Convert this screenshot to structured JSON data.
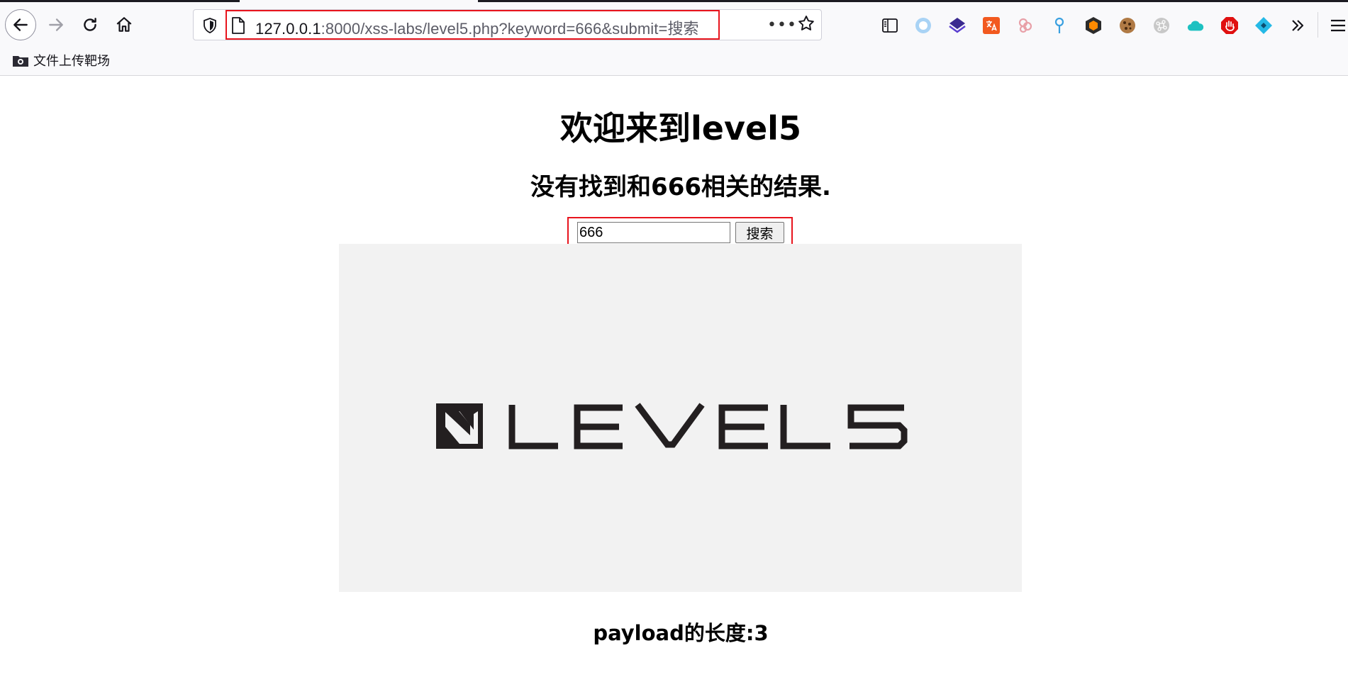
{
  "browser": {
    "url": {
      "host": "127.0.0.1",
      "rest": ":8000/xss-labs/level5.php?keyword=666&submit=搜索"
    },
    "bookmarks": [
      {
        "label": "文件上传靶场",
        "icon": "folder-icon"
      }
    ],
    "toolbar_icons": [
      "back-icon",
      "forward-icon",
      "reload-icon",
      "home-icon",
      "shield-icon",
      "page-icon",
      "more-icon",
      "star-icon",
      "sidebar-icon",
      "overflow-chevrons-icon",
      "menu-icon"
    ],
    "extensions": [
      "circle-extension-icon",
      "layers-extension-icon",
      "translate-extension-icon",
      "rings-extension-icon",
      "pin-extension-icon",
      "shield-extension-icon",
      "cookie-extension-icon",
      "command-extension-icon",
      "cloud-extension-icon",
      "stop-extension-icon",
      "diamond-extension-icon"
    ]
  },
  "page": {
    "heading": "欢迎来到level5",
    "result_text": "没有找到和666相关的结果.",
    "search": {
      "value": "666",
      "button_label": "搜索"
    },
    "banner_logo_text": "LEVEL5",
    "payload_length_text": "payload的长度:3"
  },
  "colors": {
    "highlight_box": "#e8141d",
    "banner_bg": "#f2f2f2",
    "logo": "#231f20"
  }
}
